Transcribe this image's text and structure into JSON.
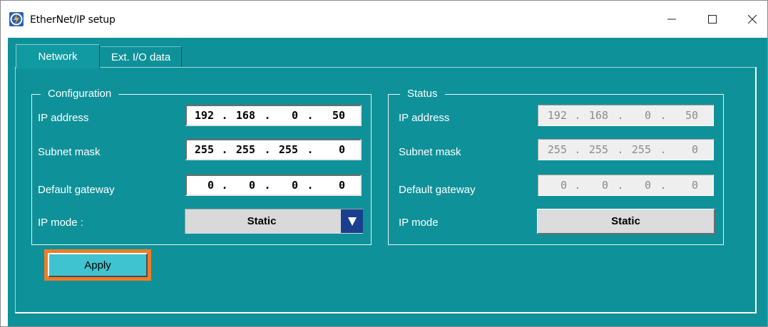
{
  "window": {
    "title": "EtherNet/IP setup"
  },
  "tabs": [
    {
      "label": "Network",
      "active": true
    },
    {
      "label": "Ext. I/O data",
      "active": false
    }
  ],
  "configuration": {
    "title": "Configuration",
    "ip_address": {
      "label": "IP address",
      "octets": [
        "192",
        "168",
        "0",
        "50"
      ]
    },
    "subnet_mask": {
      "label": "Subnet mask",
      "octets": [
        "255",
        "255",
        "255",
        "0"
      ]
    },
    "default_gateway": {
      "label": "Default gateway",
      "octets": [
        "0",
        "0",
        "0",
        "0"
      ]
    },
    "ip_mode": {
      "label": "IP mode :",
      "value": "Static"
    },
    "apply_label": "Apply"
  },
  "status": {
    "title": "Status",
    "ip_address": {
      "label": "IP address",
      "octets": [
        "192",
        "168",
        "0",
        "50"
      ]
    },
    "subnet_mask": {
      "label": "Subnet mask",
      "octets": [
        "255",
        "255",
        "255",
        "0"
      ]
    },
    "default_gateway": {
      "label": "Default gateway",
      "octets": [
        "0",
        "0",
        "0",
        "0"
      ]
    },
    "ip_mode": {
      "label": "IP mode",
      "value": "Static"
    }
  },
  "colors": {
    "background": "#0f9199",
    "highlight": "#ee7d27",
    "apply_button": "#3fc3d0",
    "dropdown_arrow": "#1a3f8f"
  },
  "icons": {
    "app": "app-logo-icon",
    "minimize": "minimize-icon",
    "maximize": "maximize-icon",
    "close": "close-icon",
    "dropdown": "chevron-down-icon"
  }
}
